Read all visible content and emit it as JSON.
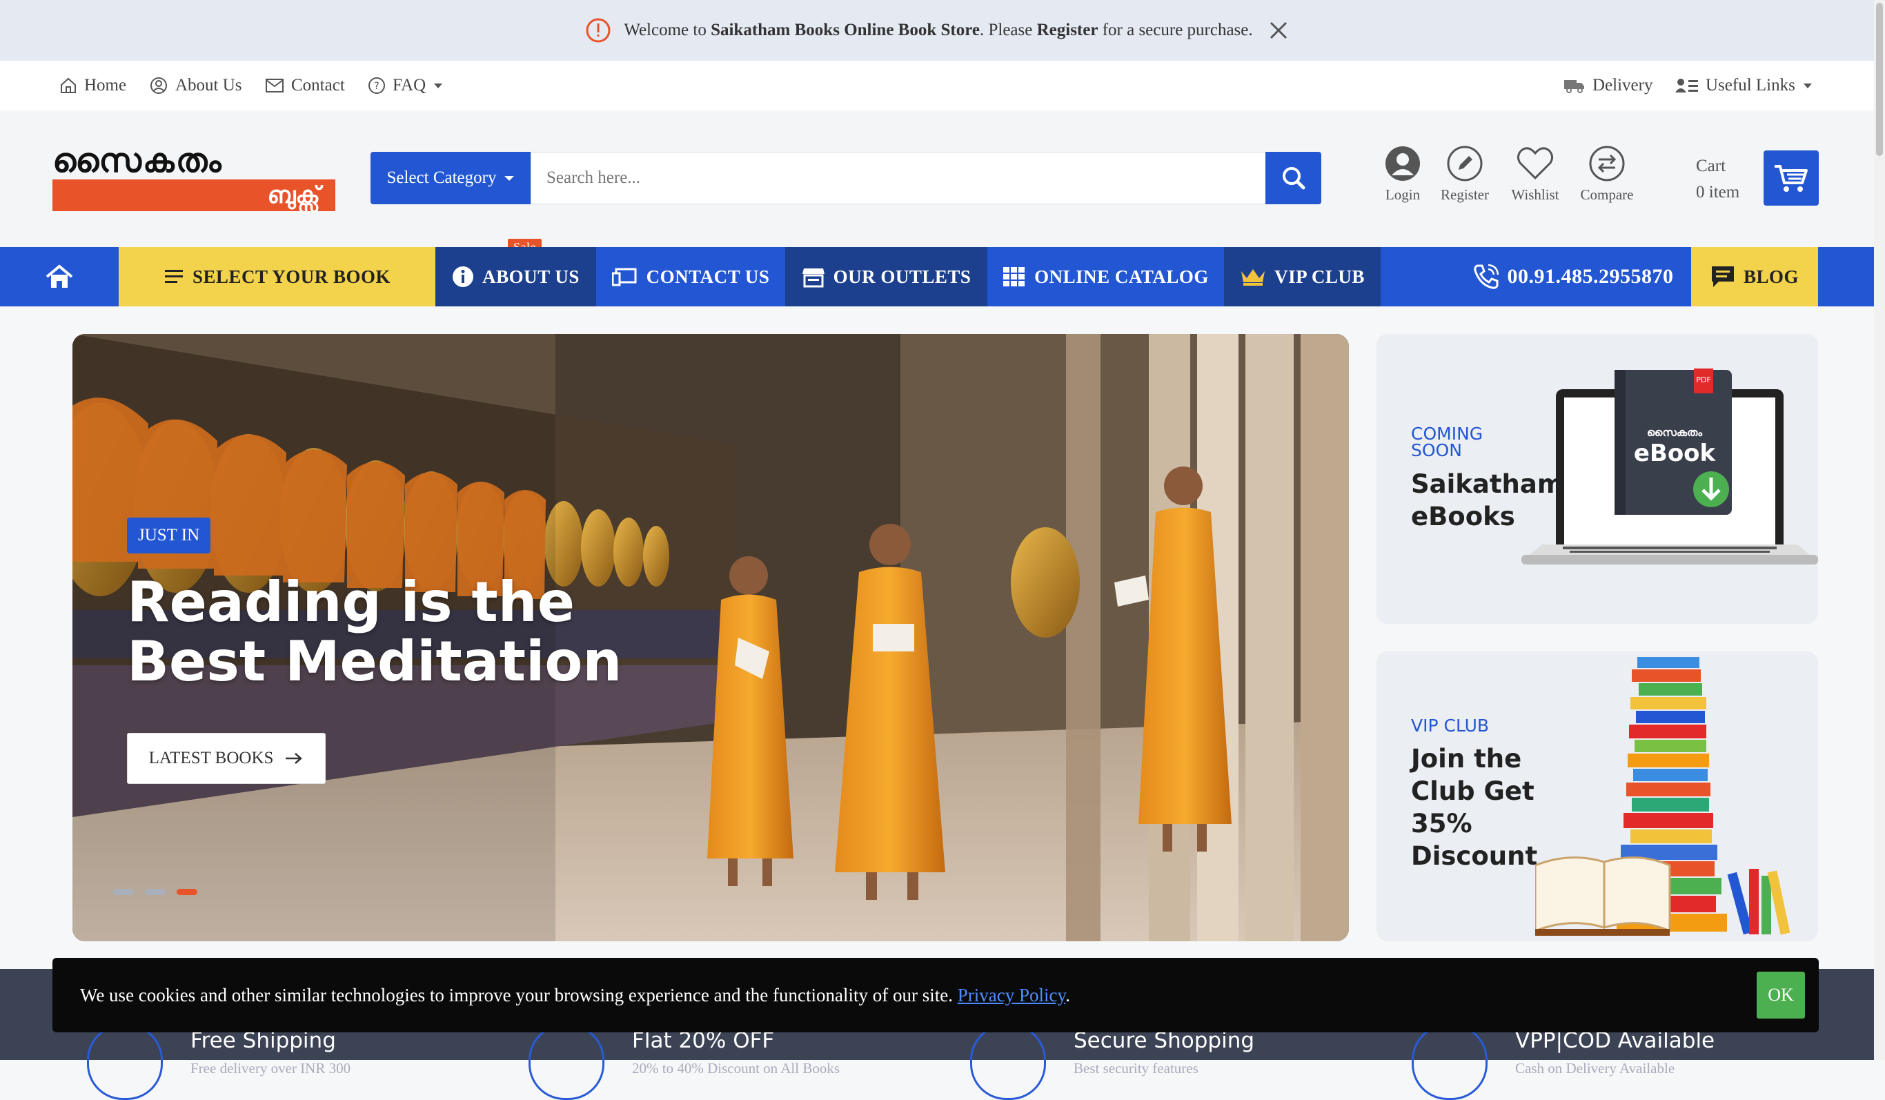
{
  "announcement": {
    "pre": "Welcome to ",
    "store": "Saikatham Books Online Book Store",
    "mid": ". Please ",
    "register": "Register",
    "post": " for a secure purchase."
  },
  "toplinks": {
    "home": "Home",
    "about": "About Us",
    "contact": "Contact",
    "faq": "FAQ",
    "delivery": "Delivery",
    "useful": "Useful Links"
  },
  "logo": {
    "top": "സൈകതം",
    "bottom": "ബുക്സ്"
  },
  "search": {
    "category": "Select Category",
    "placeholder": "Search here..."
  },
  "header_actions": {
    "login": "Login",
    "register": "Register",
    "wishlist": "Wishlist",
    "compare": "Compare",
    "cart_label": "Cart",
    "cart_count": "0 item"
  },
  "nav": {
    "select_book": "SELECT YOUR BOOK",
    "sale": "Sale",
    "about": "ABOUT US",
    "contact": "CONTACT US",
    "outlets": "OUR OUTLETS",
    "catalog": "ONLINE CATALOG",
    "vip": "VIP CLUB",
    "phone": "00.91.485.2955870",
    "blog": "BLOG"
  },
  "hero": {
    "badge": "JUST IN",
    "title_line1": "Reading is the",
    "title_line2": "Best Meditation",
    "button": "LATEST BOOKS",
    "slide_count": 3,
    "active_slide": 3
  },
  "promo1": {
    "small1": "COMING",
    "small2": "SOON",
    "big1": "Saikatham",
    "big2": "eBooks",
    "screen_logo": "സൈകതം",
    "screen_text": "eBook",
    "pdf": "PDF"
  },
  "promo2": {
    "small": "VIP CLUB",
    "big1": "Join the",
    "big2": "Club Get",
    "big3": "35%",
    "big4": "Discount"
  },
  "features": [
    {
      "title": "Free Shipping",
      "sub": "Free delivery over INR 300"
    },
    {
      "title": "Flat 20% OFF",
      "sub": "20% to 40% Discount on All Books"
    },
    {
      "title": "Secure Shopping",
      "sub": "Best security features"
    },
    {
      "title": "VPP|COD Available",
      "sub": "Cash on Delivery Available"
    }
  ],
  "cookie": {
    "text": "We use cookies and other similar technologies to improve your browsing experience and the functionality of our site. ",
    "link": "Privacy Policy",
    "end": ".",
    "ok": "OK"
  },
  "colors": {
    "brand_blue": "#2356d2",
    "nav_dark": "#1c3f8e",
    "yellow": "#f3d34b",
    "orange": "#e8532a",
    "ok_green": "#4caf50"
  }
}
